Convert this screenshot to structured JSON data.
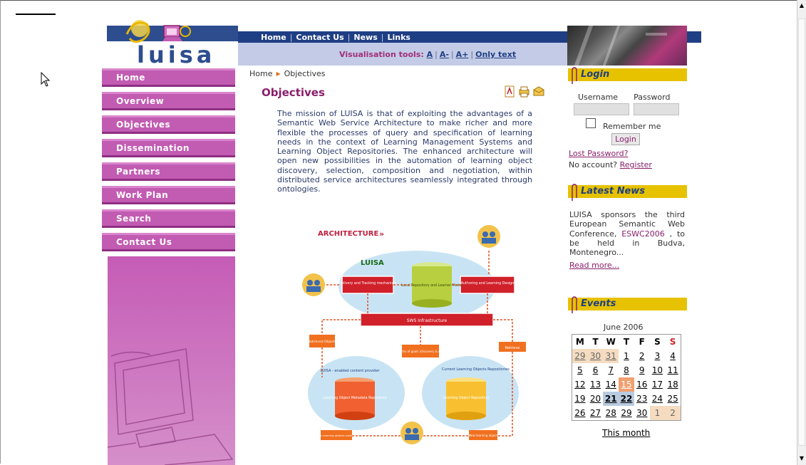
{
  "topnav": {
    "items": [
      "Home",
      "Contact Us",
      "News",
      "Links"
    ]
  },
  "logo": {
    "text": "luisa"
  },
  "visualisation": {
    "label": "Visualisation tools:",
    "options": [
      "A",
      "A-",
      "A+",
      "Only text"
    ]
  },
  "sidebar": {
    "items": [
      {
        "label": "Home"
      },
      {
        "label": "Overview"
      },
      {
        "label": "Objectives"
      },
      {
        "label": "Dissemination"
      },
      {
        "label": "Partners"
      },
      {
        "label": "Work Plan"
      },
      {
        "label": "Search"
      },
      {
        "label": "Contact Us"
      }
    ]
  },
  "breadcrumb": {
    "home": "Home",
    "current": "Objectives"
  },
  "main": {
    "title": "Objectives",
    "body": "The mission of LUISA is that of exploiting the advantages of a Semantic Web Service Architecture to make richer and more flexible the processes of query and specification of learning needs in the context of Learning Management Systems and Learning Object Repositories. The enhanced architecture will open new possibilities in the automation of learning object discovery, selection, composition and negotiation, within distributed service architectures seamlessly integrated through ontologies."
  },
  "diagram": {
    "heading": "ARCHITECTURE",
    "luisa": "LUISA",
    "delivery": "Delivery and Tracking mechanism",
    "local_repo": "Local Repository and Learner Model",
    "authoring": "Authoring and Learning Design",
    "sws": "SWS Infrastructure",
    "enabled_provider": "LUISA - enabled content provider",
    "lom_repo": "Learning Object Metadata Repository",
    "current_lo": "Current Learning Objects Repositories",
    "lo_repo": "Learning Object Repository",
    "retrieved": "Retrieved Objects",
    "ask": "Ask in terms of goals (discovery & selection)",
    "retrieve": "Retrieve",
    "public_lo": "Public learning objects metadata",
    "new_lo": "New learning object"
  },
  "login": {
    "header": "Login",
    "username_label": "Username",
    "password_label": "Password",
    "remember": "Remember me",
    "button": "Login",
    "lost": "Lost Password?",
    "no_account": "No account?",
    "register": "Register"
  },
  "news": {
    "header": "Latest News",
    "text_a": "LUISA sponsors the third European Semantic Web Conference,",
    "text_link": "ESWC2006",
    "text_b": ", to be held in Budva, Montenegro...",
    "read_more": "Read more..."
  },
  "events": {
    "header": "Events",
    "month": "June 2006",
    "days": [
      "M",
      "T",
      "W",
      "T",
      "F",
      "S",
      "S"
    ],
    "weeks": [
      [
        "29",
        "30",
        "31",
        "1",
        "2",
        "3",
        "4"
      ],
      [
        "5",
        "6",
        "7",
        "8",
        "9",
        "10",
        "11"
      ],
      [
        "12",
        "13",
        "14",
        "15",
        "16",
        "17",
        "18"
      ],
      [
        "19",
        "20",
        "21",
        "22",
        "23",
        "24",
        "25"
      ],
      [
        "26",
        "27",
        "28",
        "29",
        "30",
        "1",
        "2"
      ]
    ],
    "this_month": "This month"
  },
  "colors": {
    "brand_blue": "#1f3f84",
    "nav_magenta": "#c25bb2",
    "title_magenta": "#8a1e6a",
    "header_gold": "#e6c200"
  }
}
